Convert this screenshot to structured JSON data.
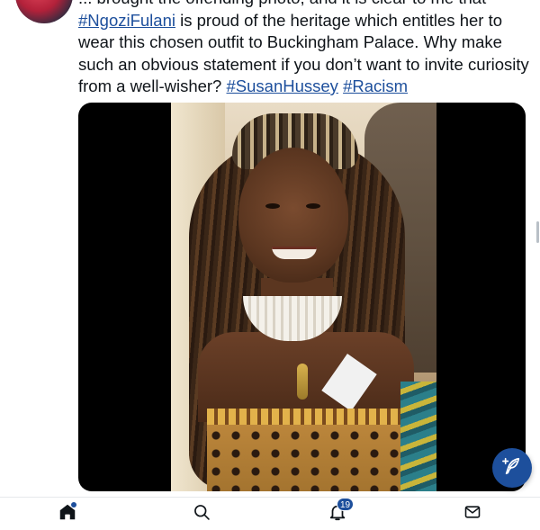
{
  "tweet": {
    "text_line_1": "... brought the offending photo, and it is clear to me that",
    "mention_fulani": "#NgoziFulani",
    "text_line_2_rest": " is proud of the heritage which entitles her to",
    "text_line_3": "wear this chosen outfit to Buckingham Palace. Why make",
    "text_line_4": "such an obvious statement if you don’t want to invite curiosity",
    "text_line_5_start": "from a well-wisher? ",
    "hashtag_hussey": "#SusanHussey",
    "hashtag_racism": "#Racism"
  },
  "tabbar": {
    "notifications_count": "19"
  },
  "colors": {
    "link": "#1d4f9c",
    "fab": "#1d4f9c",
    "text": "#0f1419"
  },
  "icons": {
    "home": "home-icon",
    "search": "search-icon",
    "notifications": "bell-icon",
    "messages": "envelope-icon",
    "compose": "feather-plus-icon"
  }
}
